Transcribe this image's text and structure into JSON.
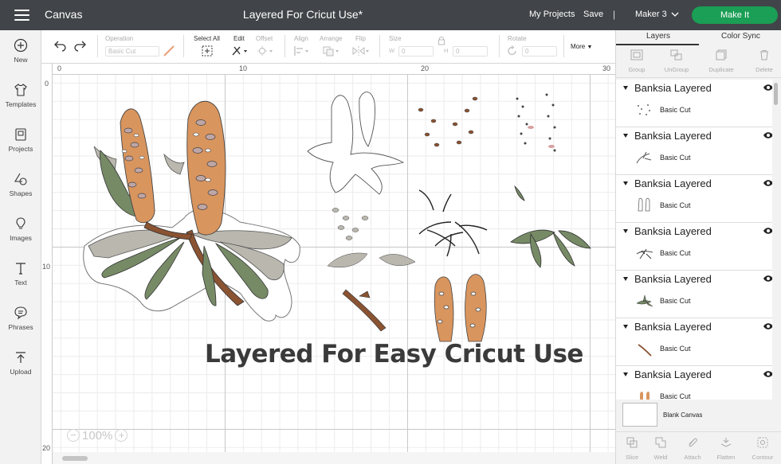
{
  "topbar": {
    "app_title": "Canvas",
    "document_title": "Layered For Cricut Use*",
    "my_projects": "My Projects",
    "save": "Save",
    "separator": "|",
    "machine": "Maker 3",
    "make_it": "Make It",
    "make_it_color": "#1b9e55"
  },
  "leftbar": {
    "items": [
      {
        "label": "New",
        "icon": "plus-circle-icon"
      },
      {
        "label": "Templates",
        "icon": "shirt-icon"
      },
      {
        "label": "Projects",
        "icon": "projects-icon"
      },
      {
        "label": "Shapes",
        "icon": "shapes-icon"
      },
      {
        "label": "Images",
        "icon": "lightbulb-icon"
      },
      {
        "label": "Text",
        "icon": "text-t-icon"
      },
      {
        "label": "Phrases",
        "icon": "speech-bubble-icon"
      },
      {
        "label": "Upload",
        "icon": "upload-icon"
      }
    ]
  },
  "toolbar": {
    "operation_label": "Operation",
    "operation_value": "Basic Cut",
    "select_all": "Select All",
    "edit": "Edit",
    "offset": "Offset",
    "align": "Align",
    "arrange": "Arrange",
    "flip": "Flip",
    "size": "Size",
    "size_w": "W",
    "size_w_value": "0",
    "size_h": "H",
    "size_h_value": "0",
    "rotate": "Rotate",
    "rotate_value": "0",
    "more": "More"
  },
  "canvas": {
    "ruler_top": [
      "0",
      "10",
      "20",
      "30"
    ],
    "ruler_left": [
      "0",
      "10",
      "20"
    ],
    "headline": "Layered For Easy Cricut Use",
    "zoom_minus": "−",
    "zoom_value": "100%",
    "zoom_plus": "+"
  },
  "rightpanel": {
    "tabs": [
      "Layers",
      "Color Sync"
    ],
    "actions": [
      "Group",
      "UnGroup",
      "Duplicate",
      "Delete"
    ],
    "layers": [
      {
        "name": "Banksia Layered",
        "sub": "Basic Cut"
      },
      {
        "name": "Banksia Layered",
        "sub": "Basic Cut"
      },
      {
        "name": "Banksia Layered",
        "sub": "Basic Cut"
      },
      {
        "name": "Banksia Layered",
        "sub": "Basic Cut"
      },
      {
        "name": "Banksia Layered",
        "sub": "Basic Cut"
      },
      {
        "name": "Banksia Layered",
        "sub": "Basic Cut"
      },
      {
        "name": "Banksia Layered",
        "sub": "Basic Cut"
      }
    ],
    "blank_canvas": "Blank Canvas",
    "bottom_actions": [
      "Slice",
      "Weld",
      "Attach",
      "Flatten",
      "Contour"
    ]
  },
  "colors": {
    "topbar_bg": "#414448",
    "banksia_orange": "#d9955e",
    "leaf_green": "#768a66",
    "leaf_grey": "#b9b7ae",
    "stem_brown": "#8a5332",
    "mauve": "#bfa6a6"
  }
}
